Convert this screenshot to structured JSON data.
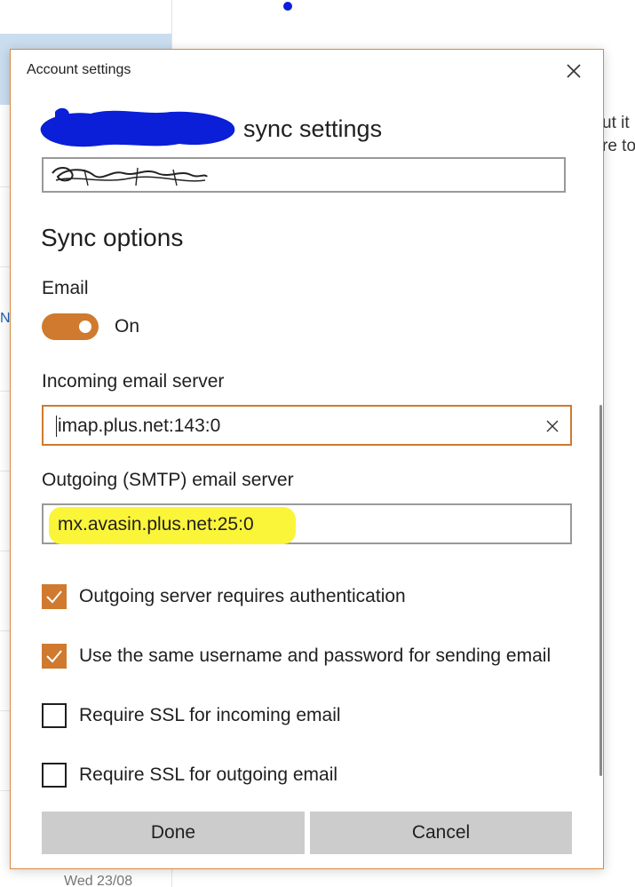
{
  "background": {
    "left_link_fragment": "No",
    "left_date_fragment": "Wed 23/08",
    "right_text_line1": "ut it i",
    "right_text_line2": "re to"
  },
  "dialog": {
    "title": "Account settings",
    "heading_suffix": "sync settings",
    "section_title": "Sync options",
    "email": {
      "label": "Email",
      "toggle_state": "On"
    },
    "incoming": {
      "label": "Incoming email server",
      "value": "imap.plus.net:143:0"
    },
    "outgoing": {
      "label": "Outgoing (SMTP) email server",
      "value": "mx.avasin.plus.net:25:0"
    },
    "checkboxes": [
      {
        "label": "Outgoing server requires authentication",
        "checked": true
      },
      {
        "label": "Use the same username and password for sending email",
        "checked": true
      },
      {
        "label": "Require SSL for incoming email",
        "checked": false
      },
      {
        "label": "Require SSL for outgoing email",
        "checked": false
      }
    ],
    "buttons": {
      "done": "Done",
      "cancel": "Cancel"
    }
  },
  "colors": {
    "accent": "#cf7a2e",
    "highlight": "#fbf53a",
    "redaction": "#0b1fd8",
    "button_bg": "#cccccc"
  },
  "icons": {
    "close": "close-icon",
    "clear": "clear-icon",
    "check": "checkmark-icon"
  }
}
